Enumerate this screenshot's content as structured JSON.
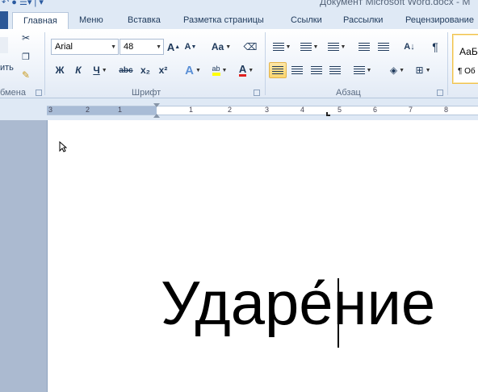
{
  "window": {
    "title": "Документ Microsoft Word.docx - M",
    "qat_glyphs": "↶ ● ☰▾ | ▾"
  },
  "tabs": [
    {
      "label": "Главная",
      "active": true
    },
    {
      "label": "Меню"
    },
    {
      "label": "Вставка"
    },
    {
      "label": "Разметка страницы"
    },
    {
      "label": "Ссылки"
    },
    {
      "label": "Рассылки"
    },
    {
      "label": "Рецензирование"
    }
  ],
  "clipboard": {
    "paste_label": "ить",
    "group_label": "бмена"
  },
  "font": {
    "name": "Arial",
    "size": "48",
    "group_label": "Шрифт",
    "grow_label": "A",
    "shrink_label": "A",
    "case_label": "Aa",
    "bold": "Ж",
    "italic": "К",
    "underline": "Ч",
    "strike": "abc",
    "subscript": "x₂",
    "superscript": "x²",
    "effects": "A",
    "highlight": "ab",
    "color": "A"
  },
  "paragraph": {
    "group_label": "Абзац",
    "pilcrow": "¶"
  },
  "styles": {
    "sample": "АаБ",
    "name": "¶ Об"
  },
  "ruler": {
    "numbers": [
      "3",
      "2",
      "1",
      "1",
      "2",
      "3",
      "4",
      "5",
      "6",
      "7",
      "8"
    ]
  },
  "document": {
    "text": "Ударе́ние"
  },
  "colors": {
    "highlight": "#ffff00",
    "font_color": "#e02020",
    "file_tab": "#2b5797"
  }
}
